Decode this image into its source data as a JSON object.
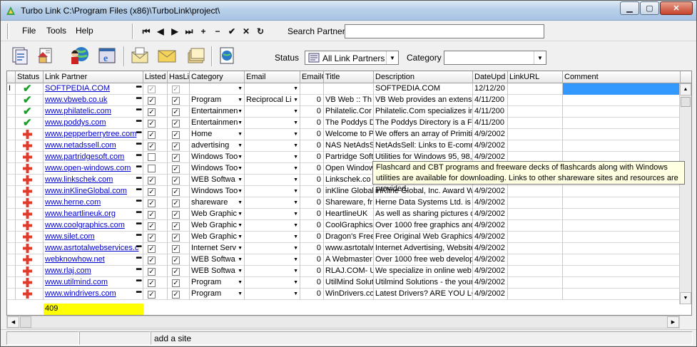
{
  "window": {
    "title": "Turbo Link C:\\Program Files (x86)\\TurboLink\\project\\"
  },
  "menu": {
    "file": "File",
    "tools": "Tools",
    "help": "Help"
  },
  "nav": {
    "first": "⏮",
    "prev": "◀",
    "next": "▶",
    "last": "⏭",
    "add": "+",
    "remove": "−",
    "accept": "✔",
    "cancel": "✕",
    "refresh": "↻"
  },
  "search": {
    "label": "Search Partner",
    "value": ""
  },
  "filters": {
    "status_label": "Status",
    "status_value": "All Link Partners",
    "category_label": "Category",
    "category_value": ""
  },
  "columns": [
    "Status",
    "Link Partner",
    "Listed",
    "HasLi",
    "Category",
    "Email",
    "EmailC",
    "Title",
    "Description",
    "DateUpd",
    "LinkURL",
    "Comment"
  ],
  "rows": [
    {
      "status": "ok",
      "partner": "SOFTPEDIA.COM",
      "listed": true,
      "haslink": true,
      "category": "",
      "email": "",
      "emailc": "",
      "title": "",
      "description": "SOFTPEDIA.COM",
      "date": "12/12/20",
      "url": "",
      "comment": "",
      "dim": true
    },
    {
      "status": "ok",
      "partner": "www.vbweb.co.uk",
      "listed": true,
      "haslink": true,
      "category": "Program",
      "email": "Reciprocal Li",
      "emailc": "0",
      "title": "VB Web :: Th",
      "description": "VB Web provides an extensi",
      "date": "4/11/200",
      "url": "",
      "comment": ""
    },
    {
      "status": "ok",
      "partner": "www.philatelic.com",
      "listed": true,
      "haslink": true,
      "category": "Entertainmen",
      "email": "",
      "emailc": "0",
      "title": " Philatelic.Cor",
      "description": "Philatelic.Com  specializes in",
      "date": "4/11/200",
      "url": "",
      "comment": ""
    },
    {
      "status": "ok",
      "partner": "www.poddys.com",
      "listed": true,
      "haslink": true,
      "category": "Entertainmen",
      "email": "",
      "emailc": "0",
      "title": "The Poddys D",
      "description": "The Poddys Directory is a Fa",
      "date": "4/11/200",
      "url": "",
      "comment": ""
    },
    {
      "status": "bad",
      "partner": "www.pepperberrytree.com",
      "listed": true,
      "haslink": true,
      "category": "Home",
      "email": "",
      "emailc": "0",
      "title": "Welcome to P",
      "description": "We offers an array of Primitiv",
      "date": "4/9/2002",
      "url": "",
      "comment": ""
    },
    {
      "status": "bad",
      "partner": "www.netadssell.com",
      "listed": true,
      "haslink": true,
      "category": "advertising",
      "email": "",
      "emailc": "0",
      "title": "NAS NetAdsS",
      "description": "NetAdsSell: Links to E-comm",
      "date": "4/9/2002",
      "url": "",
      "comment": ""
    },
    {
      "status": "bad",
      "partner": "www.partridgesoft.com",
      "listed": false,
      "haslink": true,
      "category": "Windows Too",
      "email": "",
      "emailc": "0",
      "title": "Partridge Soft",
      "description": "Utilities for Windows 95, 98, I",
      "date": "4/9/2002",
      "url": "",
      "comment": ""
    },
    {
      "status": "bad",
      "partner": "www.open-windows.com",
      "listed": false,
      "haslink": true,
      "category": "Windows Too",
      "email": "",
      "emailc": "0",
      "title": "Open Window",
      "description": "Flashcard and CBT programs",
      "date": "4/9/2002",
      "url": "",
      "comment": ""
    },
    {
      "status": "bad",
      "partner": "www.linkschek.com",
      "listed": true,
      "haslink": true,
      "category": "WEB Softwa",
      "email": "",
      "emailc": "0",
      "title": "Linkschek.co",
      "description": "",
      "date": "",
      "url": "",
      "comment": ""
    },
    {
      "status": "bad",
      "partner": "www.inKlineGlobal.com",
      "listed": true,
      "haslink": true,
      "category": "Windows Too",
      "email": "",
      "emailc": "0",
      "title": "inKline Global,",
      "description": "inKline Global, Inc. Award W",
      "date": "4/9/2002",
      "url": "",
      "comment": ""
    },
    {
      "status": "bad",
      "partner": "www.herne.com",
      "listed": true,
      "haslink": true,
      "category": "shareware",
      "email": "",
      "emailc": "0",
      "title": "Shareware, fr",
      "description": "Herne Data Systems Ltd. is a",
      "date": "4/9/2002",
      "url": "",
      "comment": ""
    },
    {
      "status": "bad",
      "partner": "www.heartlineuk.org",
      "listed": true,
      "haslink": true,
      "category": "Web Graphic",
      "email": "",
      "emailc": "0",
      "title": "HeartlineUK",
      "description": "As well as sharing pictures of",
      "date": "4/9/2002",
      "url": "",
      "comment": ""
    },
    {
      "status": "bad",
      "partner": "www.coolgraphics.com",
      "listed": true,
      "haslink": true,
      "category": "Web Graphic",
      "email": "",
      "emailc": "0",
      "title": "CoolGraphics.",
      "description": "Over 1000 free graphics and",
      "date": "4/9/2002",
      "url": "",
      "comment": ""
    },
    {
      "status": "bad",
      "partner": "www.silet.com",
      "listed": true,
      "haslink": true,
      "category": "Web Graphic",
      "email": "",
      "emailc": "0",
      "title": "Dragon's Free",
      "description": "Free Original Web Graphics,",
      "date": "4/9/2002",
      "url": "",
      "comment": ""
    },
    {
      "status": "bad",
      "partner": "www.asrtotalwebservices.c",
      "listed": true,
      "haslink": true,
      "category": "Internet Serv",
      "email": "",
      "emailc": "0",
      "title": "www.asrtotalw",
      "description": "Internet Advertising, Website",
      "date": "4/9/2002",
      "url": "",
      "comment": ""
    },
    {
      "status": "bad",
      "partner": "webknowhow.net",
      "listed": true,
      "haslink": true,
      "category": "WEB Softwa",
      "email": "",
      "emailc": "0",
      "title": "A Webmaster",
      "description": "Over 1000 free web develop",
      "date": "4/9/2002",
      "url": "",
      "comment": ""
    },
    {
      "status": "bad",
      "partner": "www.rlaj.com",
      "listed": true,
      "haslink": true,
      "category": "WEB Softwa",
      "email": "",
      "emailc": "0",
      "title": "RLAJ.COM- U",
      "description": "We specialize in online web",
      "date": "4/9/2002",
      "url": "",
      "comment": ""
    },
    {
      "status": "bad",
      "partner": "www.utilmind.com",
      "listed": true,
      "haslink": true,
      "category": "Program",
      "email": "",
      "emailc": "0",
      "title": "UtilMind Soluti",
      "description": "Utilmind Solutions - the young",
      "date": "4/9/2002",
      "url": "",
      "comment": ""
    },
    {
      "status": "bad",
      "partner": "www.windrivers.com",
      "listed": true,
      "haslink": true,
      "category": "Program",
      "email": "",
      "emailc": "0",
      "title": "WinDrivers.co",
      "description": "Latest Drivers? ARE YOU LC",
      "date": "4/9/2002",
      "url": "",
      "comment": ""
    }
  ],
  "footer": {
    "count": "409"
  },
  "tooltip": {
    "text": "Flashcard and CBT programs and freeware decks of flashcards along with Windows utilities are available for downloading. Links to other shareware sites and resources are provided."
  },
  "status": {
    "panel1": "",
    "panel2": "",
    "panel3": "add a site"
  },
  "colors": {
    "check": "#1aa028",
    "cross": "#e03b2c",
    "link": "#0000cc",
    "count_bg": "#ffff00",
    "selection": "#3399ff"
  }
}
